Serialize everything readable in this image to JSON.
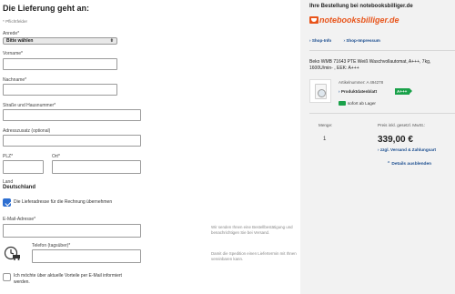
{
  "form": {
    "title": "Die Lieferung geht an:",
    "required_note": "* Pflichtfelder",
    "salutation_label": "Anrede*",
    "salutation_value": "Bitte wählen",
    "firstname_label": "Vorname*",
    "lastname_label": "Nachname*",
    "street_label": "Straße und Hausnummer*",
    "address2_label": "Adresszusatz (optional)",
    "zip_label": "PLZ*",
    "city_label": "Ort*",
    "country_label": "Land",
    "country_value": "Deutschland",
    "billing_checkbox_label": "Die Lieferadresse für die Rechnung übernehmen",
    "billing_checked": true,
    "email_label": "E-Mail-Adresse*",
    "email_hint": "Wir senden Ihnen eine Bestellbestätigung und benachrichtigen Sie bei Versand.",
    "phone_label": "Telefon (tagsüber)*",
    "phone_hint": "Damit die Spedition einen Liefertermin mit Ihnen vereinbaren kann.",
    "newsletter_label_1": "Ich möchte über aktuelle Vorteile per E-Mail informiert",
    "newsletter_label_2": "werden.",
    "newsletter_checked": false
  },
  "order": {
    "title": "Ihre Bestellung bei notebooksbilliger.de",
    "logo_text": "notebooksbilliger.de",
    "links": [
      "Shop-Info",
      "Shop-Impressum"
    ],
    "product_title_1": "Beko WMB 71643 PTE Weiß Waschvollautomat, A+++, 7kg,",
    "product_title_2": "1600U/min- , EEK: A+++",
    "article_number": "Artikelnummer: A 494278",
    "datasheet_label": "Produktdatenblatt",
    "energy_label": "A+++",
    "stock_label": "sofort ab Lager",
    "qty_header": "Menge:",
    "price_header": "Preis inkl. gesetzl. MwSt.:",
    "qty": "1",
    "price": "339,00 €",
    "shipping_link": "zzgl. Versand & Zahlungsart",
    "details_toggle": "Details ausblenden"
  },
  "colors": {
    "accent_blue": "#2e6fd1",
    "link_blue": "#1a4d8f",
    "brand_orange": "#e8541a",
    "energy_green": "#1aa14a"
  }
}
